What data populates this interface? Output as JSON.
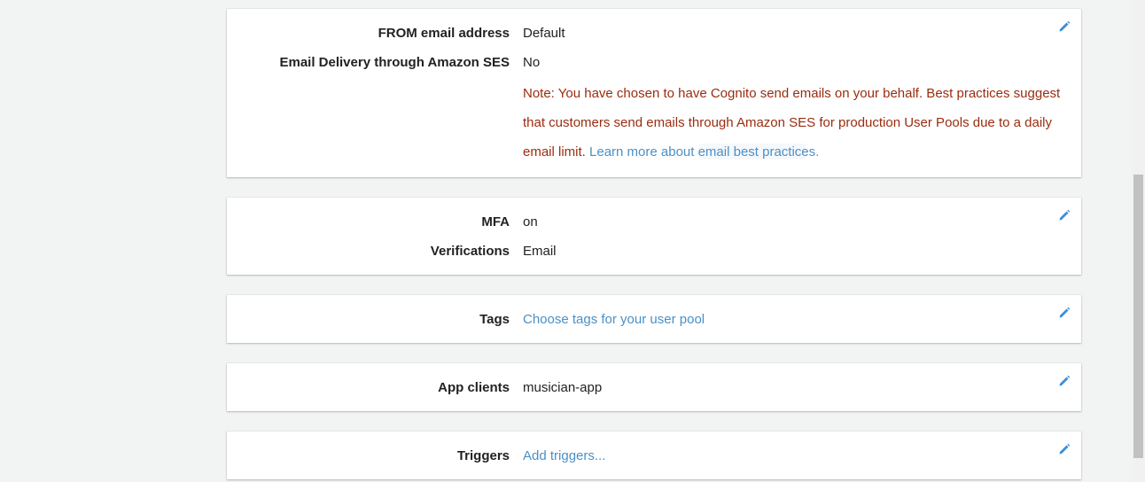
{
  "email_card": {
    "from_label": "FROM email address",
    "from_value": "Default",
    "ses_label": "Email Delivery through Amazon SES",
    "ses_value": "No",
    "note_text": "Note: You have chosen to have Cognito send emails on your behalf. Best practices suggest that customers send emails through Amazon SES for production User Pools due to a daily email limit.",
    "note_link": "Learn more about email best practices."
  },
  "mfa_card": {
    "mfa_label": "MFA",
    "mfa_value": "on",
    "verifications_label": "Verifications",
    "verifications_value": "Email"
  },
  "tags_card": {
    "label": "Tags",
    "link": "Choose tags for your user pool"
  },
  "app_clients_card": {
    "label": "App clients",
    "value": "musician-app"
  },
  "triggers_card": {
    "label": "Triggers",
    "link": "Add triggers..."
  },
  "icons": {
    "edit": "pencil-icon"
  },
  "colors": {
    "link": "#4a90c7",
    "note": "#9b2c0f",
    "edit_icon": "#3b8fd6",
    "background": "#f2f3f3"
  }
}
